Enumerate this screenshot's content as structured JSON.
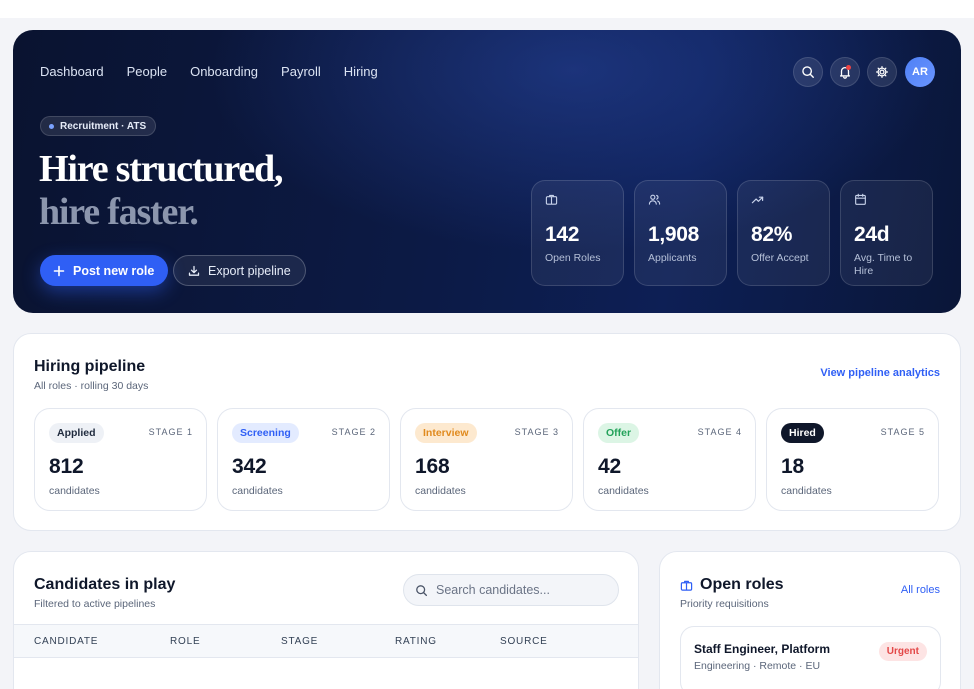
{
  "nav": [
    "Dashboard",
    "People",
    "Onboarding",
    "Payroll",
    "Hiring"
  ],
  "user": {
    "initials": "AR"
  },
  "hero": {
    "badge": "Recruitment · ATS",
    "headline_line1": "Hire structured,",
    "headline_line2": "hire faster.",
    "primary_button": "Post new role",
    "secondary_button": "Export pipeline"
  },
  "stats": [
    {
      "icon": "briefcase-icon",
      "value": "142",
      "label": "Open Roles"
    },
    {
      "icon": "users-icon",
      "value": "1,908",
      "label": "Applicants"
    },
    {
      "icon": "trend-up-icon",
      "value": "82%",
      "label": "Offer Accept"
    },
    {
      "icon": "calendar-icon",
      "value": "24d",
      "label": "Avg. Time to Hire"
    }
  ],
  "pipeline": {
    "title": "Hiring pipeline",
    "subtitle": "All roles · rolling 30 days",
    "link": "View pipeline analytics",
    "stages": [
      {
        "name": "Applied",
        "stage": "STAGE 1",
        "count": "812",
        "caption": "candidates"
      },
      {
        "name": "Screening",
        "stage": "STAGE 2",
        "count": "342",
        "caption": "candidates"
      },
      {
        "name": "Interview",
        "stage": "STAGE 3",
        "count": "168",
        "caption": "candidates"
      },
      {
        "name": "Offer",
        "stage": "STAGE 4",
        "count": "42",
        "caption": "candidates"
      },
      {
        "name": "Hired",
        "stage": "STAGE 5",
        "count": "18",
        "caption": "candidates"
      }
    ]
  },
  "candidates": {
    "title": "Candidates in play",
    "subtitle": "Filtered to active pipelines",
    "search_placeholder": "Search candidates...",
    "columns": [
      "CANDIDATE",
      "ROLE",
      "STAGE",
      "RATING",
      "SOURCE"
    ]
  },
  "roles": {
    "title": "Open roles",
    "subtitle": "Priority requisitions",
    "link": "All roles",
    "items": [
      {
        "title": "Staff Engineer, Platform",
        "meta": "Engineering · Remote · EU",
        "tag": "Urgent"
      }
    ]
  },
  "colors": {
    "accent": "#2f5ff5",
    "hero_bg": "#0c1a45",
    "urgent": "#e34848"
  }
}
